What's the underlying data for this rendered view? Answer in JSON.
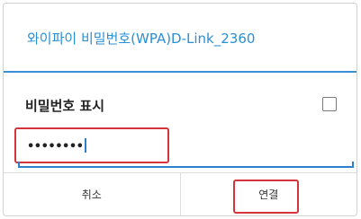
{
  "dialog": {
    "title": "와이파이 비밀번호(WPA)D-Link_2360",
    "show_password_label": "비밀번호 표시",
    "show_password_checked": false,
    "password_value": "••••••••",
    "cancel_label": "취소",
    "connect_label": "연결"
  },
  "colors": {
    "title": "#2a8fd4",
    "accent": "#2f7fcf",
    "highlight": "#d4353d"
  }
}
